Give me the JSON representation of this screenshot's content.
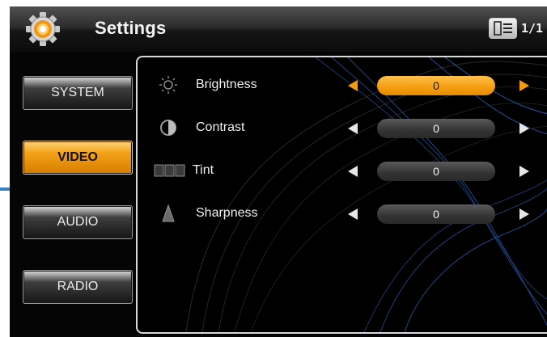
{
  "header": {
    "title": "Settings",
    "page_indicator": "1/1",
    "gear_icon": "gear-icon",
    "page_icon": "page-list-icon"
  },
  "sidebar": {
    "items": [
      {
        "label": "SYSTEM",
        "active": false
      },
      {
        "label": "VIDEO",
        "active": true
      },
      {
        "label": "AUDIO",
        "active": false
      },
      {
        "label": "RADIO",
        "active": false
      }
    ]
  },
  "video_settings": [
    {
      "label": "Brightness",
      "value": "0",
      "icon": "sun-icon",
      "selected": true
    },
    {
      "label": "Contrast",
      "value": "0",
      "icon": "contrast-icon",
      "selected": false
    },
    {
      "label": "Tint",
      "value": "0",
      "icon": "tint-icon",
      "selected": false
    },
    {
      "label": "Sharpness",
      "value": "0",
      "icon": "sharpness-icon",
      "selected": false
    }
  ],
  "colors": {
    "accent": "#f39a0e",
    "background": "#050505",
    "highlight_line": "#3e7fc4"
  }
}
